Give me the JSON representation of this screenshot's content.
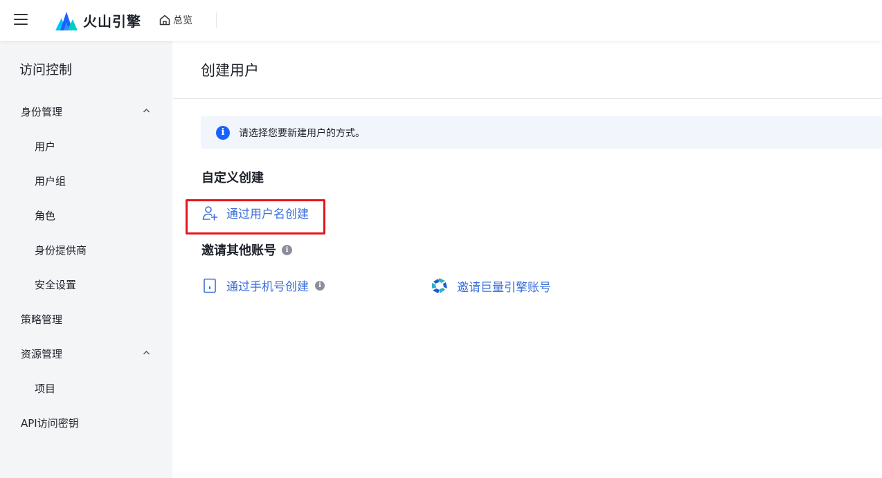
{
  "header": {
    "brand": "火山引擎",
    "home_label": "总览"
  },
  "sidebar": {
    "title": "访问控制",
    "items": [
      {
        "label": "身份管理",
        "level": 1,
        "expanded": true
      },
      {
        "label": "用户",
        "level": 2
      },
      {
        "label": "用户组",
        "level": 2
      },
      {
        "label": "角色",
        "level": 2
      },
      {
        "label": "身份提供商",
        "level": 2
      },
      {
        "label": "安全设置",
        "level": 2
      },
      {
        "label": "策略管理",
        "level": 1
      },
      {
        "label": "资源管理",
        "level": 1,
        "expanded": true
      },
      {
        "label": "项目",
        "level": 2
      },
      {
        "label": "API访问密钥",
        "level": 1
      }
    ]
  },
  "main": {
    "title": "创建用户",
    "info_text": "请选择您要新建用户的方式。",
    "custom_section": "自定义创建",
    "create_by_username": "通过用户名创建",
    "invite_section": "邀请其他账号",
    "create_by_phone": "通过手机号创建",
    "invite_oceanengine": "邀请巨量引擎账号"
  },
  "colors": {
    "accent": "#1664ff",
    "link": "#3b6fd9",
    "highlight": "#e5141c",
    "sidebar_bg": "#f4f5f7",
    "info_bg": "#f2f5fc"
  }
}
